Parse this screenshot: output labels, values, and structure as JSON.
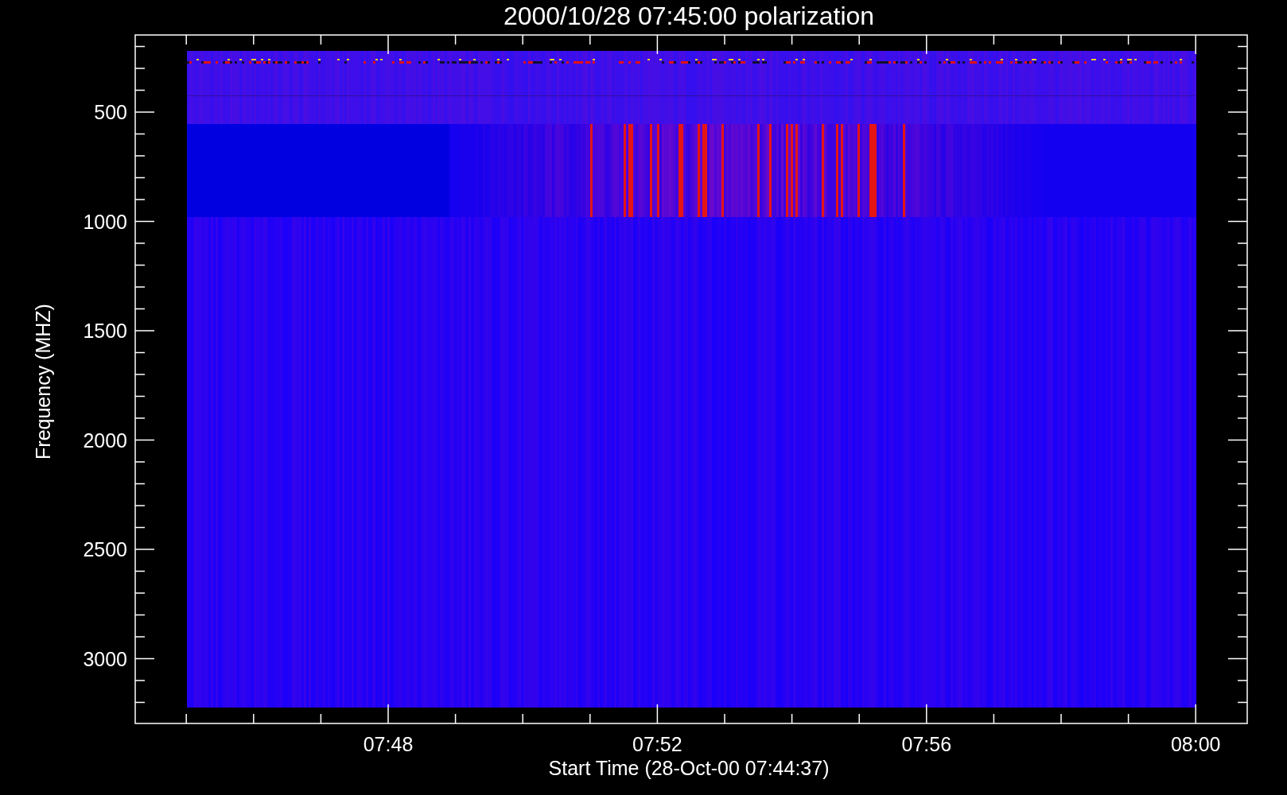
{
  "title": "2000/10/28 07:45:00 polarization",
  "y_axis": {
    "label": "Frequency (MHZ)",
    "ticks": [
      "500",
      "1000",
      "1500",
      "2000",
      "2500",
      "3000"
    ]
  },
  "x_axis": {
    "label": "Start Time (28-Oct-00 07:44:37)",
    "ticks": [
      "07:48",
      "07:52",
      "07:56",
      "08:00"
    ]
  }
}
